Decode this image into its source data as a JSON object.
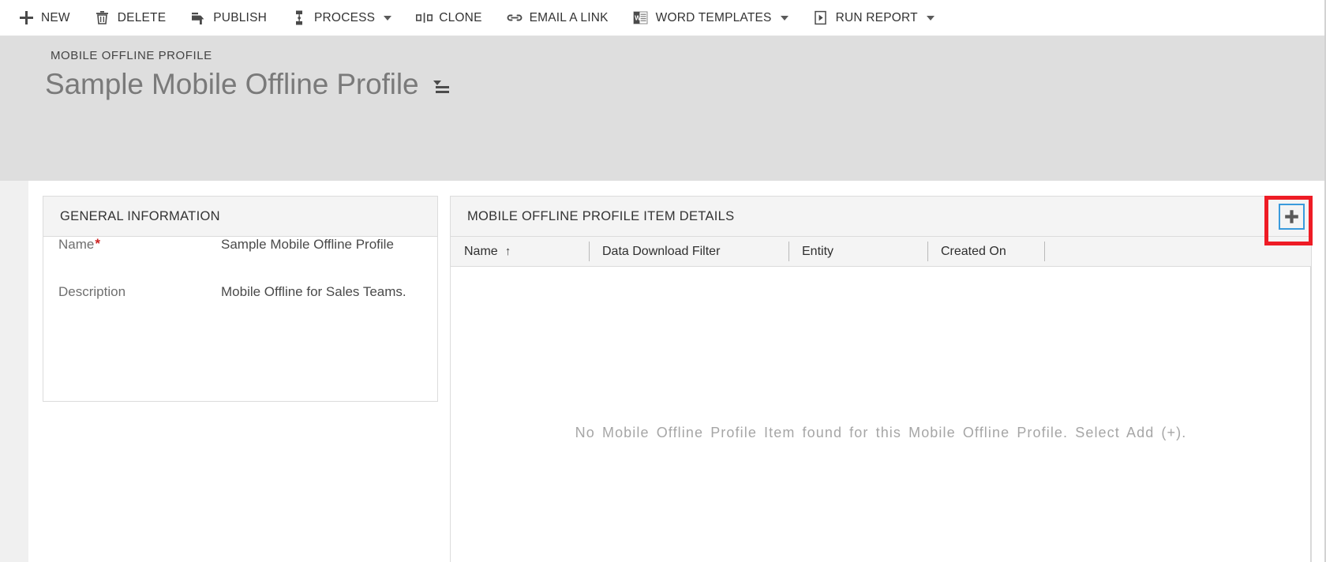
{
  "commandbar": {
    "items": [
      {
        "label": "NEW",
        "icon": "plus-icon",
        "has_caret": false
      },
      {
        "label": "DELETE",
        "icon": "trash-icon",
        "has_caret": false
      },
      {
        "label": "PUBLISH",
        "icon": "publish-icon",
        "has_caret": false
      },
      {
        "label": "PROCESS",
        "icon": "process-icon",
        "has_caret": true
      },
      {
        "label": "CLONE",
        "icon": "clone-icon",
        "has_caret": false
      },
      {
        "label": "EMAIL A LINK",
        "icon": "link-icon",
        "has_caret": false
      },
      {
        "label": "WORD TEMPLATES",
        "icon": "word-document-icon",
        "has_caret": true
      },
      {
        "label": "RUN REPORT",
        "icon": "run-report-icon",
        "has_caret": true
      }
    ]
  },
  "header": {
    "entity_type": "MOBILE OFFLINE PROFILE",
    "record_title": "Sample Mobile Offline Profile",
    "title_menu_icon": "record-set-menu-icon"
  },
  "general_information": {
    "section_title": "GENERAL INFORMATION",
    "fields": [
      {
        "label": "Name",
        "required": true,
        "value": "Sample Mobile Offline Profile"
      },
      {
        "label": "Description",
        "required": false,
        "value": "Mobile Offline for Sales Teams."
      }
    ]
  },
  "grid": {
    "section_title": "MOBILE OFFLINE PROFILE ITEM DETAILS",
    "add_button_label": "+",
    "add_button_icon": "plus-icon",
    "columns": [
      {
        "label": "Name",
        "sorted": true,
        "sort_glyph": "↑"
      },
      {
        "label": "Data Download Filter",
        "sorted": false,
        "sort_glyph": ""
      },
      {
        "label": "Entity",
        "sorted": false,
        "sort_glyph": ""
      },
      {
        "label": "Created On",
        "sorted": false,
        "sort_glyph": ""
      }
    ],
    "empty_message": "No Mobile Offline Profile Item found for this Mobile Offline Profile. Select Add (+)."
  },
  "colors": {
    "header_band": "#dedede",
    "section_header_bg": "#f4f4f4",
    "required_star": "#cc2222",
    "annotation_box": "#ee1c25",
    "focus_border": "#3a9bdc",
    "empty_text": "#a6a6a6"
  }
}
